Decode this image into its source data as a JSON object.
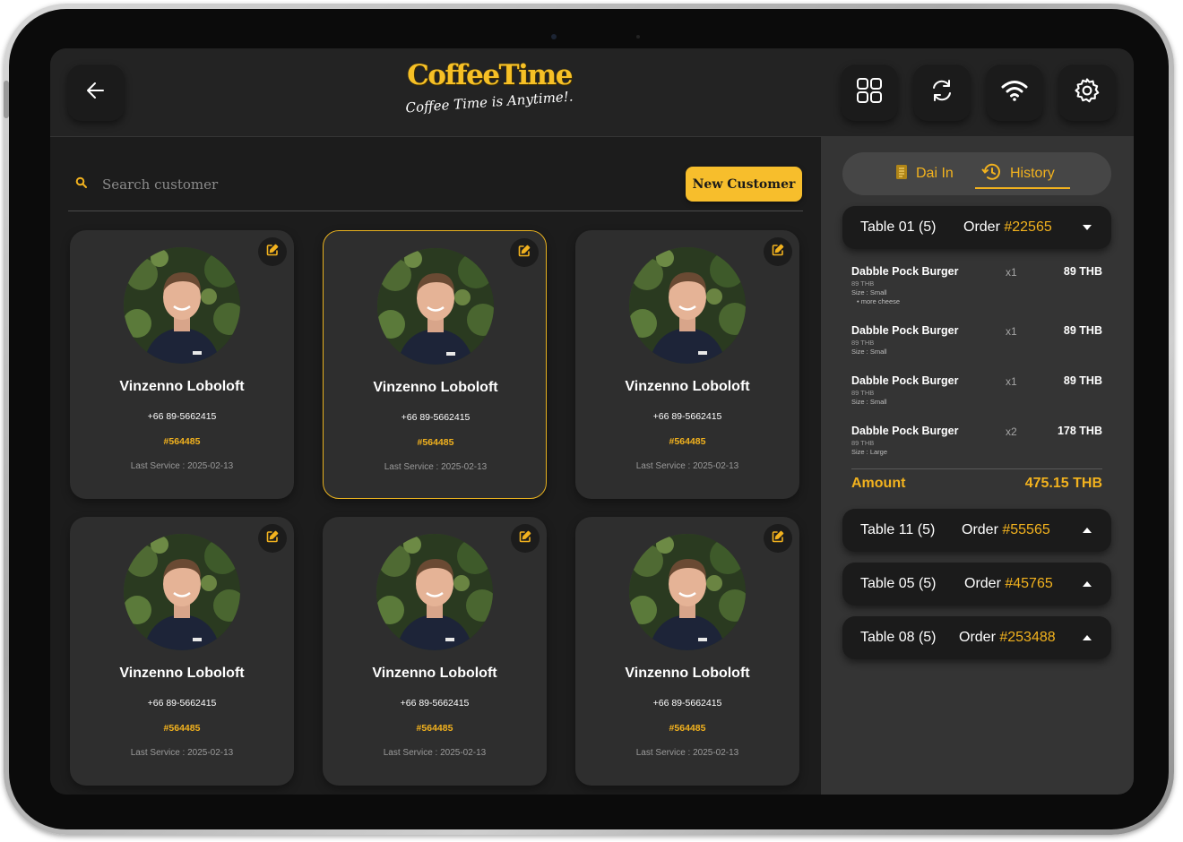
{
  "header": {
    "logo_title": "CoffeeTime",
    "logo_tagline": "Coffee Time is Anytime!."
  },
  "icons": {
    "back": "arrow-left",
    "apps": "grid-2x2",
    "sync": "refresh-arrows",
    "wifi": "wifi",
    "settings": "gear",
    "search": "magnifier",
    "edit": "pencil-square",
    "dine_in": "receipt",
    "history": "clock-history"
  },
  "search": {
    "placeholder": "Search customer",
    "value": ""
  },
  "new_customer_label": "New Customer",
  "customers": [
    {
      "name": "Vinzenno Loboloft",
      "phone": "+66 89-5662415",
      "code": "#564485",
      "last_service": "Last Service : 2025-02-13",
      "selected": false
    },
    {
      "name": "Vinzenno Loboloft",
      "phone": "+66 89-5662415",
      "code": "#564485",
      "last_service": "Last Service : 2025-02-13",
      "selected": true
    },
    {
      "name": "Vinzenno Loboloft",
      "phone": "+66 89-5662415",
      "code": "#564485",
      "last_service": "Last Service : 2025-02-13",
      "selected": false
    },
    {
      "name": "Vinzenno Loboloft",
      "phone": "+66 89-5662415",
      "code": "#564485",
      "last_service": "Last Service : 2025-02-13",
      "selected": false
    },
    {
      "name": "Vinzenno Loboloft",
      "phone": "+66 89-5662415",
      "code": "#564485",
      "last_service": "Last Service : 2025-02-13",
      "selected": false
    },
    {
      "name": "Vinzenno Loboloft",
      "phone": "+66 89-5662415",
      "code": "#564485",
      "last_service": "Last Service : 2025-02-13",
      "selected": false
    }
  ],
  "panel": {
    "tabs": [
      {
        "label": "Dai In",
        "active": false
      },
      {
        "label": "History",
        "active": true
      }
    ],
    "orders": [
      {
        "table": "Table 01 (5)",
        "order_label": "Order",
        "order_number": "#22565",
        "expanded": true
      },
      {
        "table": "Table 11 (5)",
        "order_label": "Order",
        "order_number": "#55565",
        "expanded": false
      },
      {
        "table": "Table 05 (5)",
        "order_label": "Order",
        "order_number": "#45765",
        "expanded": false
      },
      {
        "table": "Table 08 (5)",
        "order_label": "Order",
        "order_number": "#253488",
        "expanded": false
      }
    ],
    "items": [
      {
        "name": "Dabble Pock Burger",
        "unit_price": "89 THB",
        "size": "Size : Small",
        "extra": "•  more cheese",
        "qty": "x1",
        "total": "89 THB"
      },
      {
        "name": "Dabble Pock Burger",
        "unit_price": "89 THB",
        "size": "Size : Small",
        "extra": "",
        "qty": "x1",
        "total": "89 THB"
      },
      {
        "name": "Dabble Pock Burger",
        "unit_price": "89 THB",
        "size": "Size : Small",
        "extra": "",
        "qty": "x1",
        "total": "89 THB"
      },
      {
        "name": "Dabble Pock Burger",
        "unit_price": "89 THB",
        "size": "Size : Large",
        "extra": "",
        "qty": "x2",
        "total": "178 THB"
      }
    ],
    "amount_label": "Amount",
    "amount_value": "475.15 THB"
  },
  "colors": {
    "accent": "#f2b21e",
    "background": "#1c1c1c",
    "panel": "#343434",
    "card": "#2e2e2e"
  }
}
